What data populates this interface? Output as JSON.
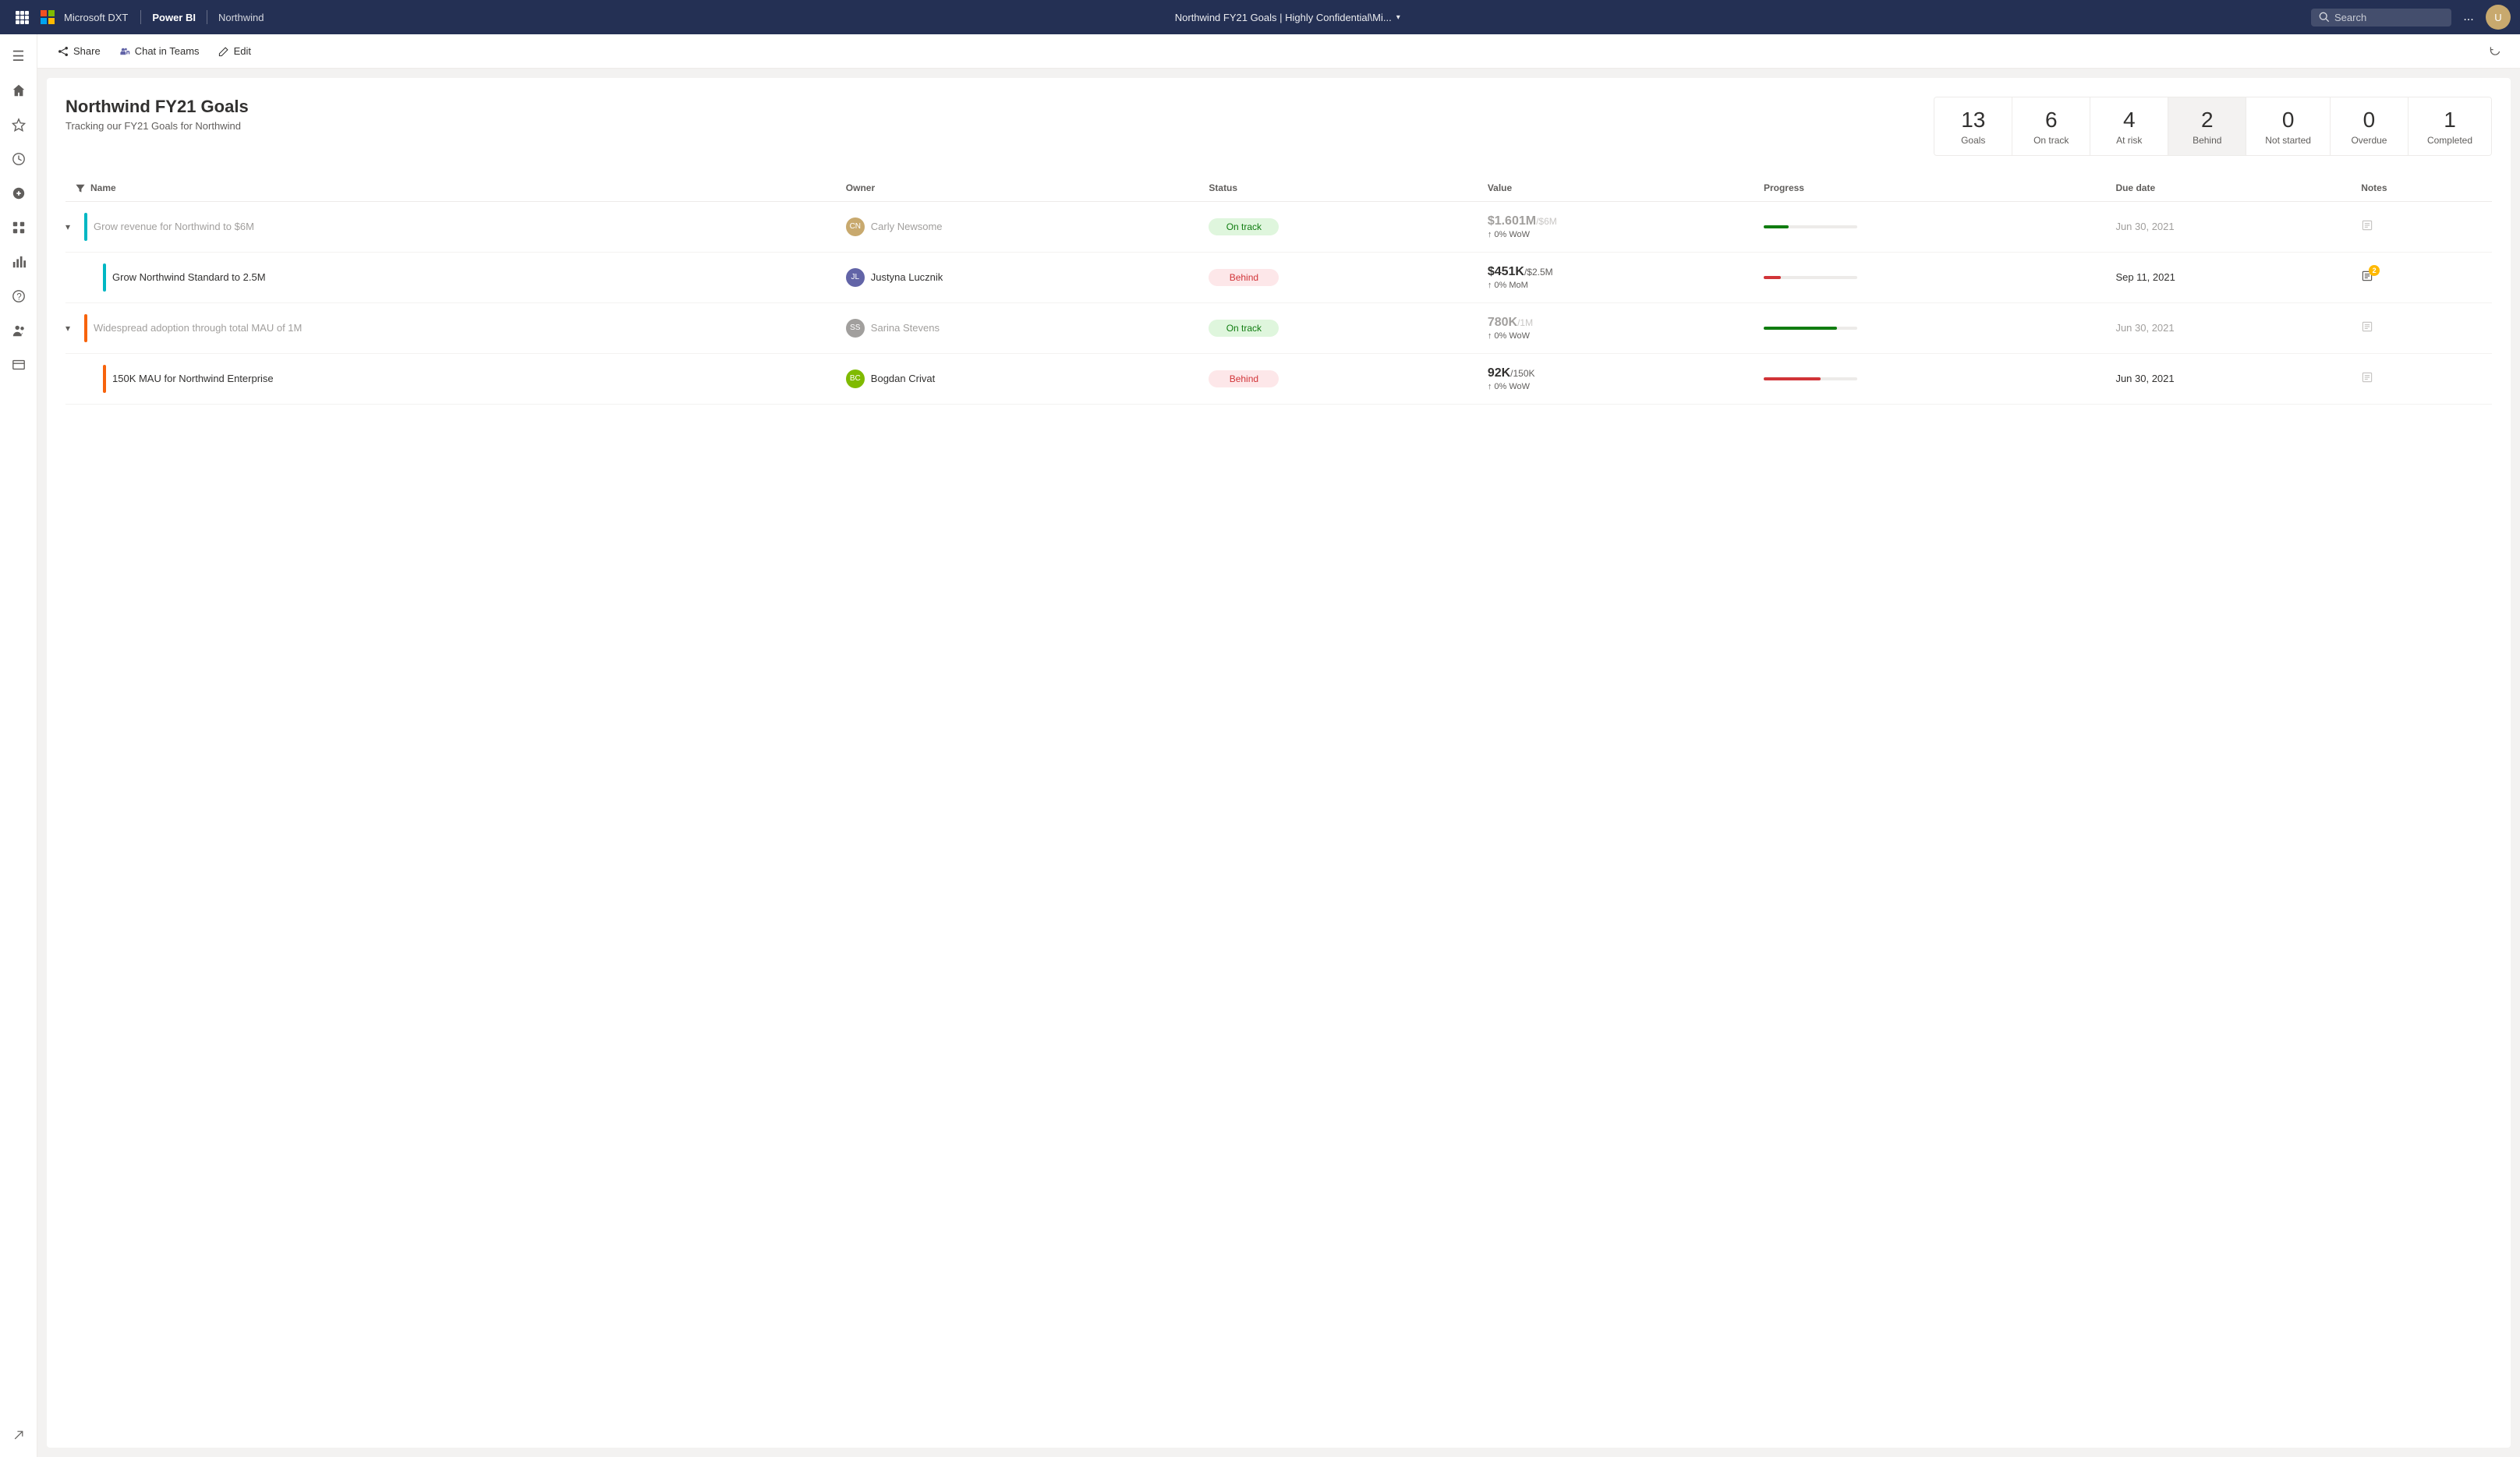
{
  "topNav": {
    "appGridLabel": "App grid",
    "brandName": "Microsoft DXT",
    "appName": "Power BI",
    "workspaceName": "Northwind",
    "docTitle": "Northwind FY21 Goals  |  Highly Confidential\\Mi...",
    "searchPlaceholder": "Search",
    "moreLabel": "...",
    "avatarInitial": "U"
  },
  "subNav": {
    "shareLabel": "Share",
    "chatLabel": "Chat in Teams",
    "editLabel": "Edit"
  },
  "page": {
    "title": "Northwind FY21 Goals",
    "subtitle": "Tracking our FY21 Goals for Northwind"
  },
  "stats": [
    {
      "num": "13",
      "label": "Goals",
      "active": false
    },
    {
      "num": "6",
      "label": "On track",
      "active": false
    },
    {
      "num": "4",
      "label": "At risk",
      "active": false
    },
    {
      "num": "2",
      "label": "Behind",
      "active": true
    },
    {
      "num": "0",
      "label": "Not started",
      "active": false
    },
    {
      "num": "0",
      "label": "Overdue",
      "active": false
    },
    {
      "num": "1",
      "label": "Completed",
      "active": false
    }
  ],
  "table": {
    "columns": {
      "name": "Name",
      "owner": "Owner",
      "status": "Status",
      "value": "Value",
      "progress": "Progress",
      "dueDate": "Due date",
      "notes": "Notes"
    }
  },
  "goals": [
    {
      "id": "goal-1",
      "name": "Grow revenue for Northwind to $6M",
      "barColor": "#00b7c3",
      "dimmed": true,
      "expanded": true,
      "owner": {
        "name": "Carly Newsome",
        "initials": "CN",
        "color": "#c8a96e"
      },
      "status": "On track",
      "statusType": "on-track",
      "value": "$1.601M",
      "target": "/$6M",
      "trend": "↑ 0% WoW",
      "progressPct": 27,
      "progressColor": "green",
      "dueDate": "Jun 30, 2021",
      "notesCount": 0
    },
    {
      "id": "goal-1-sub",
      "name": "Grow Northwind Standard to 2.5M",
      "barColor": "#00b7c3",
      "dimmed": false,
      "expanded": false,
      "subgoal": true,
      "owner": {
        "name": "Justyna Lucznik",
        "initials": "JL",
        "color": "#6264a7"
      },
      "status": "Behind",
      "statusType": "behind",
      "value": "$451K",
      "target": "/$2.5M",
      "trend": "↑ 0% MoM",
      "progressPct": 18,
      "progressColor": "red",
      "dueDate": "Sep 11, 2021",
      "notesCount": 2
    },
    {
      "id": "goal-2",
      "name": "Widespread adoption through total MAU of 1M",
      "barColor": "#f7630c",
      "dimmed": true,
      "expanded": true,
      "owner": {
        "name": "Sarina Stevens",
        "initials": "SS",
        "color": "#a19f9d"
      },
      "status": "On track",
      "statusType": "on-track",
      "value": "780K",
      "target": "/1M",
      "trend": "↑ 0% WoW",
      "progressPct": 78,
      "progressColor": "green",
      "dueDate": "Jun 30, 2021",
      "notesCount": 0
    },
    {
      "id": "goal-2-sub",
      "name": "150K MAU for Northwind Enterprise",
      "barColor": "#f7630c",
      "dimmed": false,
      "expanded": false,
      "subgoal": true,
      "owner": {
        "name": "Bogdan Crivat",
        "initials": "BC",
        "color": "#7fba00"
      },
      "status": "Behind",
      "statusType": "behind",
      "value": "92K",
      "target": "/150K",
      "trend": "↑ 0% WoW",
      "progressPct": 61,
      "progressColor": "red",
      "dueDate": "Jun 30, 2021",
      "notesCount": 0
    }
  ],
  "sidebar": {
    "items": [
      {
        "name": "home",
        "icon": "⌂",
        "active": false
      },
      {
        "name": "favorites",
        "icon": "★",
        "active": false
      },
      {
        "name": "recent",
        "icon": "⏱",
        "active": false
      },
      {
        "name": "create",
        "icon": "+",
        "active": false
      },
      {
        "name": "apps",
        "icon": "⊞",
        "active": false
      },
      {
        "name": "metrics",
        "icon": "📊",
        "active": false
      },
      {
        "name": "learn",
        "icon": "?",
        "active": false
      },
      {
        "name": "people",
        "icon": "👤",
        "active": false
      },
      {
        "name": "workspaces",
        "icon": "🗂",
        "active": false
      },
      {
        "name": "browse",
        "icon": "≡",
        "active": false
      }
    ]
  }
}
